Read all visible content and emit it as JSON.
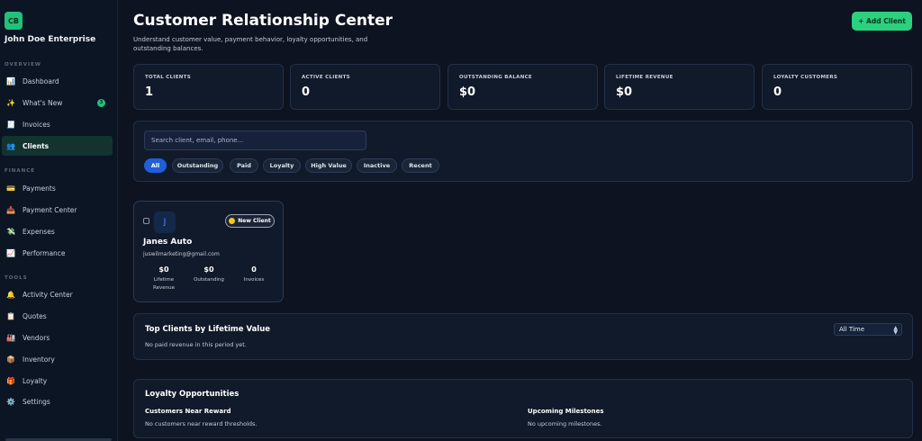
{
  "brand": {
    "initials": "CB",
    "name": "John Doe Enterprise"
  },
  "sidebar": {
    "sections": {
      "overview": "OVERVIEW",
      "finance": "FINANCE",
      "tools": "TOOLS"
    },
    "items": [
      {
        "label": "Dashboard",
        "icon": "📊"
      },
      {
        "label": "What's New",
        "icon": "✨",
        "badge": "3"
      },
      {
        "label": "Invoices",
        "icon": "🧾"
      },
      {
        "label": "Clients",
        "icon": "👥"
      },
      {
        "label": "Payments",
        "icon": "💳"
      },
      {
        "label": "Payment Center",
        "icon": "📥"
      },
      {
        "label": "Expenses",
        "icon": "💸"
      },
      {
        "label": "Performance",
        "icon": "📈"
      },
      {
        "label": "Activity Center",
        "icon": "🔔"
      },
      {
        "label": "Quotes",
        "icon": "📋"
      },
      {
        "label": "Vendors",
        "icon": "🏭"
      },
      {
        "label": "Inventory",
        "icon": "📦"
      },
      {
        "label": "Loyalty",
        "icon": "🎁"
      },
      {
        "label": "Settings",
        "icon": "⚙️"
      }
    ]
  },
  "header": {
    "title": "Customer Relationship Center",
    "subtitle": "Understand customer value, payment behavior, loyalty opportunities, and outstanding balances.",
    "add_label": "+ Add Client"
  },
  "stats": [
    {
      "label": "TOTAL CLIENTS",
      "value": "1"
    },
    {
      "label": "ACTIVE CLIENTS",
      "value": "0"
    },
    {
      "label": "OUTSTANDING BALANCE",
      "value": "$0"
    },
    {
      "label": "LIFETIME REVENUE",
      "value": "$0"
    },
    {
      "label": "LOYALTY CUSTOMERS",
      "value": "0"
    }
  ],
  "search": {
    "placeholder": "Search client, email, phone..."
  },
  "filters": [
    "All",
    "Outstanding",
    "Paid",
    "Loyalty",
    "High Value",
    "Inactive",
    "Recent"
  ],
  "client_card": {
    "avatar_letter": "J",
    "badge": "New Client",
    "name": "Janes Auto",
    "email": "juswilmarketing@gmail.com",
    "metrics": [
      {
        "value": "$0",
        "label_line1": "Lifetime",
        "label_line2": "Revenue"
      },
      {
        "value": "$0",
        "label_line1": "Outstanding",
        "label_line2": ""
      },
      {
        "value": "0",
        "label_line1": "Invoices",
        "label_line2": ""
      }
    ]
  },
  "top_clients": {
    "title": "Top Clients by Lifetime Value",
    "empty": "No paid revenue in this period yet.",
    "period": "All Time"
  },
  "loyalty": {
    "title": "Loyalty Opportunities",
    "near_reward_title": "Customers Near Reward",
    "near_reward_empty": "No customers near reward thresholds.",
    "milestones_title": "Upcoming Milestones",
    "milestones_empty": "No upcoming milestones."
  }
}
